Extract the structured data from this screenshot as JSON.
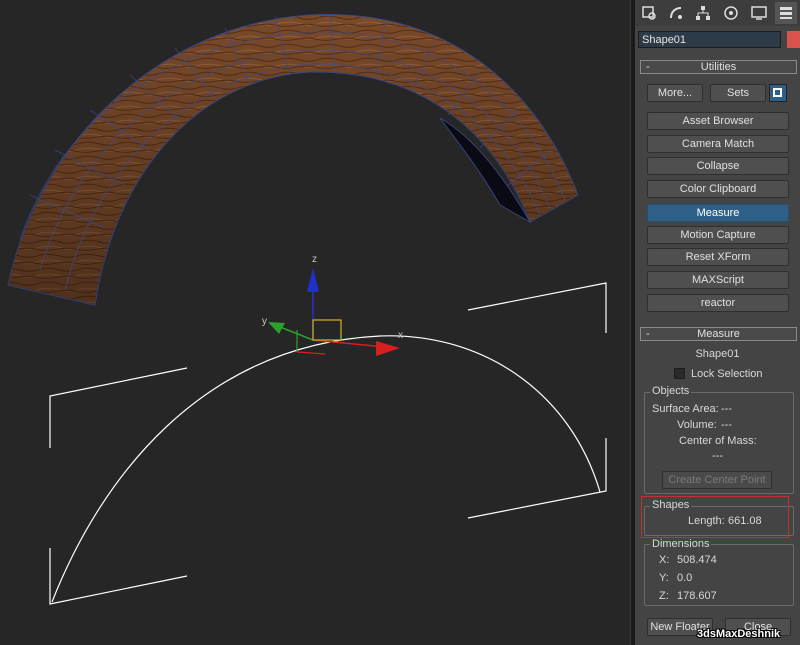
{
  "viewport": {
    "axis_labels": {
      "x": "x",
      "y": "y",
      "z": "z"
    }
  },
  "command_panel": {
    "tabs": [
      "create-tab-icon",
      "modify-tab-icon",
      "hierarchy-tab-icon",
      "motion-tab-icon",
      "display-tab-icon",
      "utilities-tab-icon"
    ],
    "object_name": "Shape01",
    "object_color": "#d9534f",
    "utilities_rollout": {
      "title": "Utilities",
      "toggle": "-",
      "more_label": "More...",
      "sets_label": "Sets",
      "items": [
        "Asset Browser",
        "Camera Match",
        "Collapse",
        "Color Clipboard",
        "Measure",
        "Motion Capture",
        "Reset XForm",
        "MAXScript",
        "reactor"
      ],
      "active_item": "Measure"
    },
    "measure_rollout": {
      "title": "Measure",
      "toggle": "-",
      "object": "Shape01",
      "lock_selection_label": "Lock Selection",
      "lock_selection_checked": false,
      "objects_group": {
        "title": "Objects",
        "surface_area_label": "Surface Area:",
        "surface_area_value": "---",
        "volume_label": "Volume:",
        "volume_value": "---",
        "center_of_mass_label": "Center of Mass:",
        "center_of_mass_value": "---",
        "create_center_point_label": "Create Center Point"
      },
      "shapes_group": {
        "title": "Shapes",
        "length_label": "Length:",
        "length_value": "661.08"
      },
      "dimensions_group": {
        "title": "Dimensions",
        "x_label": "X:",
        "x_value": "508.474",
        "y_label": "Y:",
        "y_value": "0.0",
        "z_label": "Z:",
        "z_value": "178.607"
      },
      "new_floater_label": "New Floater",
      "close_label": "Close"
    }
  },
  "watermark": "3dsMaxDeshnik",
  "colors": {
    "viewport_bg": "#262626",
    "panel_bg": "#444444",
    "active_button": "#2e5f86",
    "highlight_box": "#c0332b",
    "axis_x": "#d62020",
    "axis_y": "#2ca02c",
    "axis_z": "#2030d0"
  }
}
